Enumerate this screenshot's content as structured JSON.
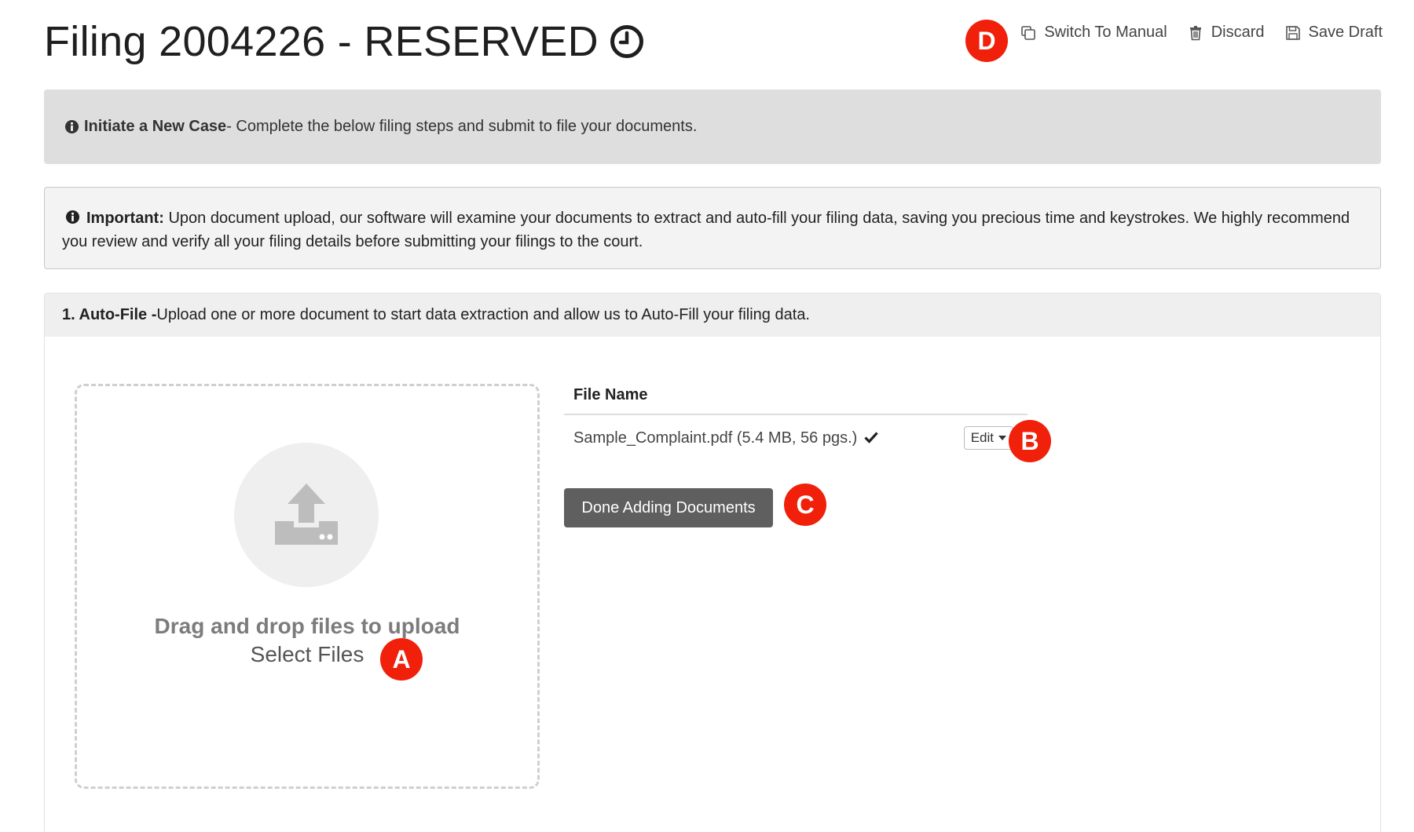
{
  "header": {
    "title": "Filing 2004226 - RESERVED",
    "clock_icon": "clock-icon",
    "actions": {
      "switch_manual": "Switch To Manual",
      "discard": "Discard",
      "save_draft": "Save Draft"
    }
  },
  "notice": {
    "bold": "Initiate a New Case",
    "text": " - Complete the below filing steps and submit to file your documents."
  },
  "important": {
    "bold": "Important:",
    "text": " Upon document upload, our software will examine your documents to extract and auto-fill your filing data, saving you precious time and keystrokes. We highly recommend you review and verify all your filing details before submitting your filings to the court."
  },
  "autofile": {
    "header_bold": "1. Auto-File -",
    "header_text": " Upload one or more document to start data extraction and allow us to Auto-Fill your filing data.",
    "dropzone_title": "Drag and drop files to upload",
    "dropzone_link": "Select Files",
    "table_header": "File Name",
    "files": [
      {
        "name": "Sample_Complaint.pdf (5.4 MB, 56 pgs.)",
        "status_icon": "checkmark-icon",
        "edit_label": "Edit"
      }
    ],
    "done_button": "Done Adding Documents"
  },
  "markers": {
    "a": "A",
    "b": "B",
    "c": "C",
    "d": "D"
  },
  "colors": {
    "marker": "#f0200a",
    "done_button": "#5f5f5f",
    "notice_bg": "#dedede"
  }
}
